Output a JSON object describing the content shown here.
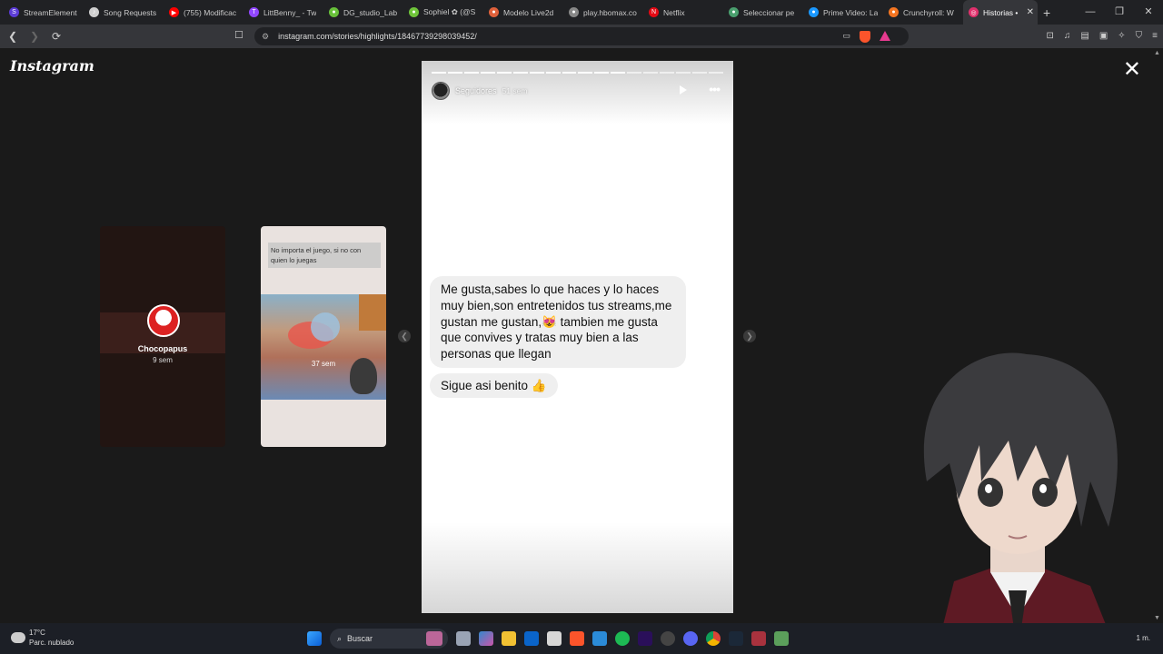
{
  "browser": {
    "tabs": [
      {
        "title": "StreamElement",
        "color": "#5b3bd6",
        "glyph": "S"
      },
      {
        "title": "Song Requests",
        "color": "#cfcfcf",
        "glyph": "♪"
      },
      {
        "title": "(755) Modificac",
        "color": "#ff0000",
        "glyph": "▶"
      },
      {
        "title": "LittBenny_ - Tw",
        "color": "#9146ff",
        "glyph": "T"
      },
      {
        "title": "DG_studio_Lab",
        "color": "#68c13a",
        "glyph": "●"
      },
      {
        "title": "Sophiel ✿ (@S",
        "color": "#6fc43a",
        "glyph": "●"
      },
      {
        "title": "Modelo Live2d",
        "color": "#e0613b",
        "glyph": "●"
      },
      {
        "title": "play.hbomax.co",
        "color": "#888888",
        "glyph": "●"
      },
      {
        "title": "Netflix",
        "color": "#e50914",
        "glyph": "N"
      },
      {
        "title": "Seleccionar pe",
        "color": "#4a9f6e",
        "glyph": "●"
      },
      {
        "title": "Prime Video: La",
        "color": "#1a98ff",
        "glyph": "●"
      },
      {
        "title": "Crunchyroll: W",
        "color": "#f47521",
        "glyph": "●"
      },
      {
        "title": "Historias •",
        "color": "#e1306c",
        "glyph": "◎",
        "active": true
      }
    ],
    "new_tab": "+",
    "window_controls": [
      "—",
      "❐",
      "✕"
    ],
    "url": "instagram.com/stories/highlights/18467739298039452/"
  },
  "page": {
    "logo": "Instagram",
    "close": "✕",
    "left_preview": {
      "name": "Chocopapus",
      "time": "9 sem"
    },
    "mid_preview": {
      "caption": "No importa el juego, si no con quien lo juegas",
      "time": "37 sem"
    },
    "story": {
      "username": "Seguidores",
      "time_ago": "51 sem",
      "progress_total": 18,
      "progress_done": 12,
      "message1": "Me gusta,sabes lo que haces y lo haces muy bien,son entretenidos tus streams,me gustan me gustan,😻 tambien me gusta que convives y tratas muy bien a las personas que llegan",
      "message2": "Sigue asi benito 👍"
    }
  },
  "taskbar": {
    "weather_temp": "17°C",
    "weather_desc": "Parc. nublado",
    "search_placeholder": "Buscar",
    "tray": "1 m."
  }
}
